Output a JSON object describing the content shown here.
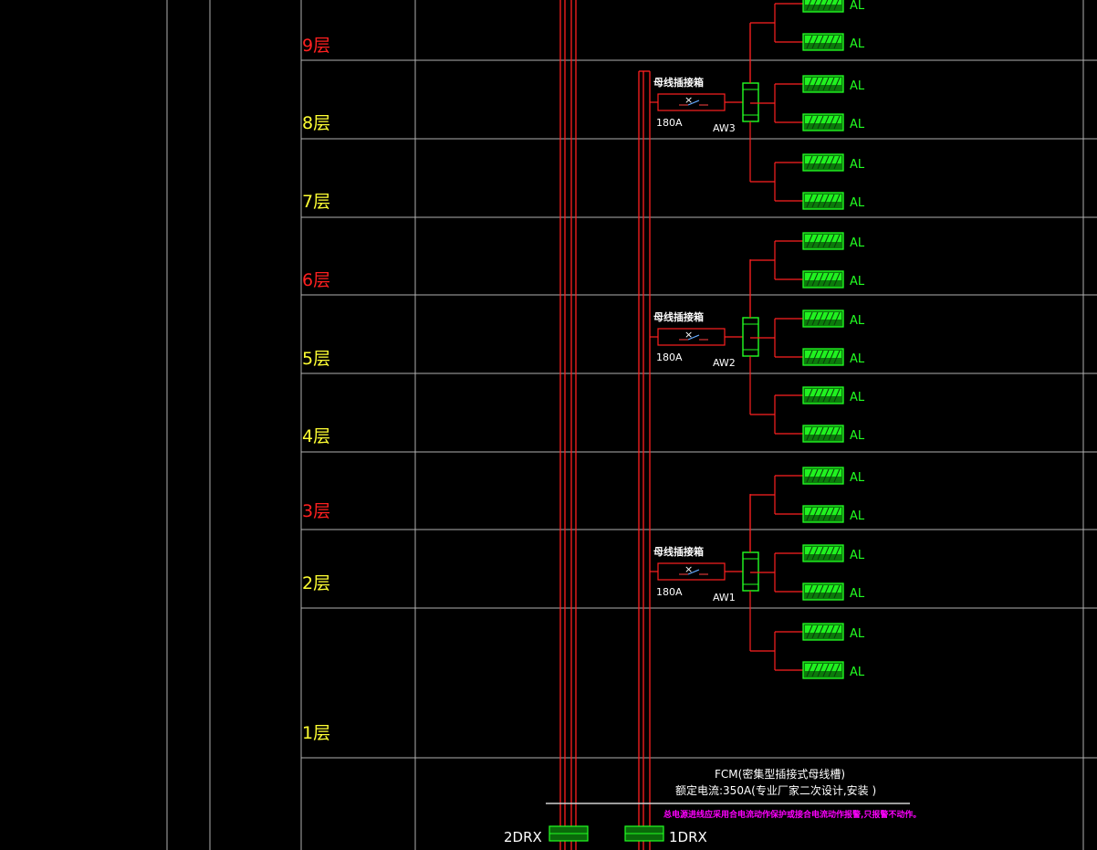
{
  "colors": {
    "background": "#000000",
    "grid_line": "#b0b0b0",
    "riser_red": "#ff2020",
    "equipment_green": "#22ff22",
    "floor_yellow": "#ffff33",
    "floor_red": "#ff2020",
    "warning_magenta": "#ff00ff"
  },
  "floors": [
    {
      "label": "9层",
      "color": "red"
    },
    {
      "label": "8层",
      "color": "yellow"
    },
    {
      "label": "7层",
      "color": "yellow"
    },
    {
      "label": "6层",
      "color": "red"
    },
    {
      "label": "5层",
      "color": "yellow"
    },
    {
      "label": "4层",
      "color": "yellow"
    },
    {
      "label": "3层",
      "color": "red"
    },
    {
      "label": "2层",
      "color": "yellow"
    },
    {
      "label": "1层",
      "color": "yellow"
    }
  ],
  "tap_off_units": [
    {
      "title": "母线插接箱",
      "rating": "180A",
      "tag": "AW3"
    },
    {
      "title": "母线插接箱",
      "rating": "180A",
      "tag": "AW2"
    },
    {
      "title": "母线插接箱",
      "rating": "180A",
      "tag": "AW1"
    }
  ],
  "panel_label": "AL",
  "busway_note": {
    "line1": "FCM(密集型插接式母线槽)",
    "line2": "额定电流:350A(专业厂家二次设计,安装 )",
    "warning": "总电源进线应采用合电流动作保护或接合电流动作报警,只报警不动作。"
  },
  "feeders": [
    {
      "label": "2DRX"
    },
    {
      "label": "1DRX"
    }
  ]
}
